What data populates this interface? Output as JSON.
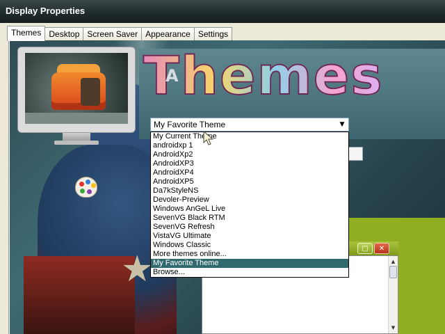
{
  "window": {
    "title": "Display Properties"
  },
  "tabs": [
    {
      "label": "Themes",
      "active": true
    },
    {
      "label": "Desktop",
      "active": false
    },
    {
      "label": "Screen Saver",
      "active": false
    },
    {
      "label": "Appearance",
      "active": false
    },
    {
      "label": "Settings",
      "active": false
    }
  ],
  "preview": {
    "banner_text": "Themes",
    "badge_letter": "A"
  },
  "theme_combo": {
    "selected": "My Favorite Theme",
    "arrow_icon": "dropdown-arrow-icon",
    "options": [
      "My Current Theme",
      "androidxp 1",
      "AndroidXp2",
      "AndroidXP3",
      "AndroidXP4",
      "AndroidXP5",
      "Da7kStyleNS",
      "Devoler-Preview",
      "Windows AnGeL Live",
      "SevenVG Black RTM",
      "SevenVG Refresh",
      "VistaVG Ultimate",
      "Windows Classic",
      "More themes online...",
      "My Favorite Theme",
      "Browse..."
    ],
    "highlighted_index": 14
  },
  "mini_window": {
    "maximize_icon": "maximize-icon",
    "close_icon": "close-icon"
  },
  "colors": {
    "selection": "#316a6e",
    "preview_green": "#8fae22"
  }
}
